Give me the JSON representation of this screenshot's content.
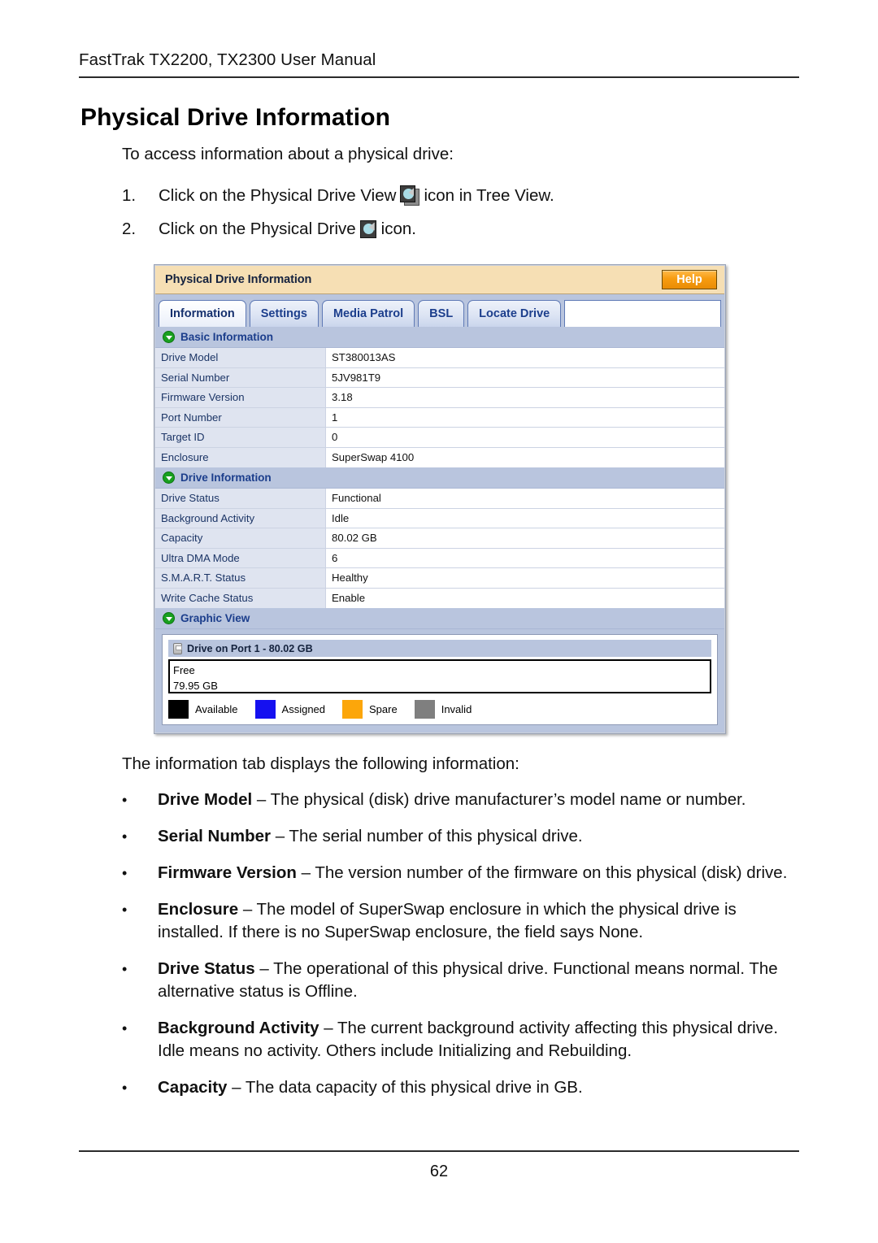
{
  "document": {
    "running_header": "FastTrak TX2200, TX2300 User Manual",
    "page_title": "Physical Drive Information",
    "intro": "To access information about a physical drive:",
    "page_number": "62"
  },
  "steps": [
    {
      "number": "1.",
      "text_before": "Click on the Physical Drive View",
      "icon": "physical-drive-view-icon",
      "text_after": "icon in Tree View."
    },
    {
      "number": "2.",
      "text_before": "Click on the Physical Drive",
      "icon": "physical-drive-icon",
      "text_after": "icon."
    }
  ],
  "screenshot": {
    "titlebar": {
      "title": "Physical Drive Information",
      "help_label": "Help"
    },
    "tabs": [
      {
        "label": "Information",
        "active": true
      },
      {
        "label": "Settings",
        "active": false
      },
      {
        "label": "Media Patrol",
        "active": false
      },
      {
        "label": "BSL",
        "active": false
      },
      {
        "label": "Locate Drive",
        "active": false
      }
    ],
    "sections": [
      {
        "title": "Basic Information",
        "rows": [
          {
            "key": "Drive Model",
            "value": "ST380013AS"
          },
          {
            "key": "Serial Number",
            "value": "5JV981T9"
          },
          {
            "key": "Firmware Version",
            "value": "3.18"
          },
          {
            "key": "Port Number",
            "value": "1"
          },
          {
            "key": "Target ID",
            "value": "0"
          },
          {
            "key": "Enclosure",
            "value": "SuperSwap 4100"
          }
        ]
      },
      {
        "title": "Drive Information",
        "rows": [
          {
            "key": "Drive Status",
            "value": "Functional"
          },
          {
            "key": "Background Activity",
            "value": "Idle"
          },
          {
            "key": "Capacity",
            "value": "80.02 GB"
          },
          {
            "key": "Ultra DMA Mode",
            "value": "6"
          },
          {
            "key": "S.M.A.R.T. Status",
            "value": "Healthy"
          },
          {
            "key": "Write Cache Status",
            "value": "Enable"
          }
        ]
      }
    ],
    "graphic_view": {
      "title": "Graphic View",
      "drive_header": "Drive on Port 1 - 80.02 GB",
      "segment_label": "Free",
      "segment_size": "79.95 GB",
      "legend": [
        {
          "label": "Available",
          "color": "#000000"
        },
        {
          "label": "Assigned",
          "color": "#1510f0"
        },
        {
          "label": "Spare",
          "color": "#fca60a"
        },
        {
          "label": "Invalid",
          "color": "#7f7f7f"
        }
      ]
    },
    "colors": {
      "titlebar_bg": "#f6dfb4",
      "help_button": "#f79c10",
      "tab_strip_bg": "#b9c5de",
      "tab_text": "#1c3e8c",
      "section_arrow": "#18a01f",
      "row_key_bg": "#dfe4f0"
    }
  },
  "after": {
    "lead": "The information tab displays the following information:",
    "bullets": [
      {
        "term": "Drive Model",
        "desc": " – The physical (disk) drive manufacturer’s model name or number."
      },
      {
        "term": "Serial Number",
        "desc": " – The serial number of this physical drive."
      },
      {
        "term": "Firmware Version",
        "desc": " – The version number of the firmware on this physical (disk) drive."
      },
      {
        "term": "Enclosure",
        "desc": " – The model of SuperSwap enclosure in which the physical drive is installed. If there is no SuperSwap enclosure, the field says None."
      },
      {
        "term": "Drive Status",
        "desc": " – The operational of this physical drive. Functional means normal. The alternative status is Offline."
      },
      {
        "term": "Background Activity",
        "desc": " – The current background activity affecting this physical drive. Idle means no activity. Others include Initializing and Rebuilding."
      },
      {
        "term": "Capacity",
        "desc": " – The data capacity of this physical drive in GB."
      }
    ],
    "bullet_marker": "•"
  }
}
